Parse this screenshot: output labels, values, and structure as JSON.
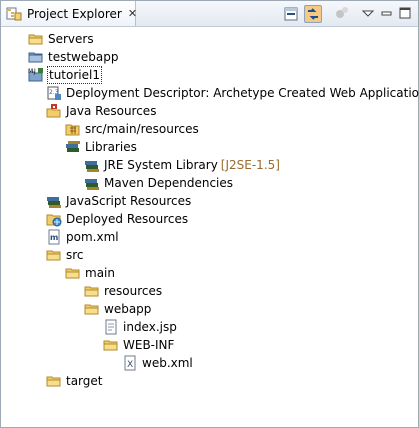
{
  "view": {
    "title": "Project Explorer",
    "close_glyph": "✕",
    "icon": "project-explorer-icon"
  },
  "toolbar": {
    "collapse_all": "collapse-all-icon",
    "link_with_editor": "link-with-editor-icon",
    "view_menu": "view-menu-icon",
    "minimize": "minimize-icon",
    "maximize": "maximize-icon"
  },
  "tree": {
    "items": [
      {
        "label": "Servers",
        "icon": "folder-icon"
      },
      {
        "label": "testwebapp",
        "icon": "closed-project-icon"
      },
      {
        "label": "tutoriel1",
        "icon": "maven-web-project-icon"
      },
      {
        "label": "Deployment Descriptor: Archetype Created Web Application",
        "icon": "deployment-descriptor-icon"
      },
      {
        "label": "Java Resources",
        "icon": "java-resources-icon"
      },
      {
        "label": "src/main/resources",
        "icon": "source-folder-icon"
      },
      {
        "label": "Libraries",
        "icon": "libraries-icon"
      },
      {
        "label": "JRE System Library",
        "icon": "library-icon",
        "decoration": "[J2SE-1.5]"
      },
      {
        "label": "Maven Dependencies",
        "icon": "library-icon"
      },
      {
        "label": "JavaScript Resources",
        "icon": "library-icon"
      },
      {
        "label": "Deployed Resources",
        "icon": "deployed-resources-icon"
      },
      {
        "label": "pom.xml",
        "icon": "maven-pom-icon"
      },
      {
        "label": "src",
        "icon": "folder-icon"
      },
      {
        "label": "main",
        "icon": "folder-icon"
      },
      {
        "label": "resources",
        "icon": "folder-icon"
      },
      {
        "label": "webapp",
        "icon": "folder-icon"
      },
      {
        "label": "index.jsp",
        "icon": "jsp-file-icon"
      },
      {
        "label": "WEB-INF",
        "icon": "folder-icon"
      },
      {
        "label": "web.xml",
        "icon": "xml-file-icon"
      },
      {
        "label": "target",
        "icon": "folder-icon"
      }
    ]
  }
}
